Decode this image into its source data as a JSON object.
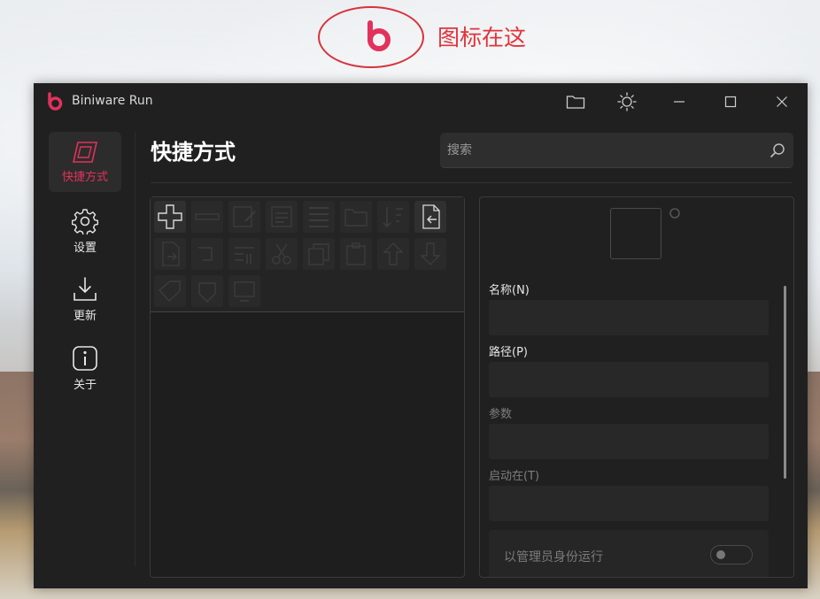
{
  "annotation": {
    "text": "图标在这",
    "color": "#e0343a"
  },
  "window": {
    "title": "Biniware Run",
    "accent": "#e2325b",
    "titlebar_buttons": [
      "folder-icon",
      "theme-icon",
      "minimize-icon",
      "maximize-icon",
      "close-icon"
    ]
  },
  "nav": {
    "items": [
      {
        "label": "快捷方式",
        "icon": "shortcut-icon",
        "active": true
      },
      {
        "label": "设置",
        "icon": "gear-icon",
        "active": false
      },
      {
        "label": "更新",
        "icon": "download-icon",
        "active": false
      },
      {
        "label": "关于",
        "icon": "info-icon",
        "active": false
      }
    ]
  },
  "main": {
    "title": "快捷方式",
    "search": {
      "placeholder": "搜索",
      "value": ""
    }
  },
  "toolbar": {
    "tools": [
      "add-icon",
      "remove-icon",
      "edit-icon",
      "properties-icon",
      "list-icon",
      "open-folder-icon",
      "sort-icon",
      "import-icon",
      "export-icon",
      "move-icon",
      "group-icon",
      "cut-icon",
      "copy-icon",
      "paste-icon",
      "move-up-icon",
      "move-down-icon",
      "tag-icon",
      "pin-icon",
      "screen-icon"
    ]
  },
  "detail": {
    "name_label": "名称(N)",
    "name_value": "",
    "path_label": "路径(P)",
    "path_value": "",
    "params_label": "参数",
    "params_value": "",
    "start_in_label": "启动在(T)",
    "start_in_value": "",
    "run_as_admin_label": "以管理员身份运行",
    "run_as_admin": false
  }
}
